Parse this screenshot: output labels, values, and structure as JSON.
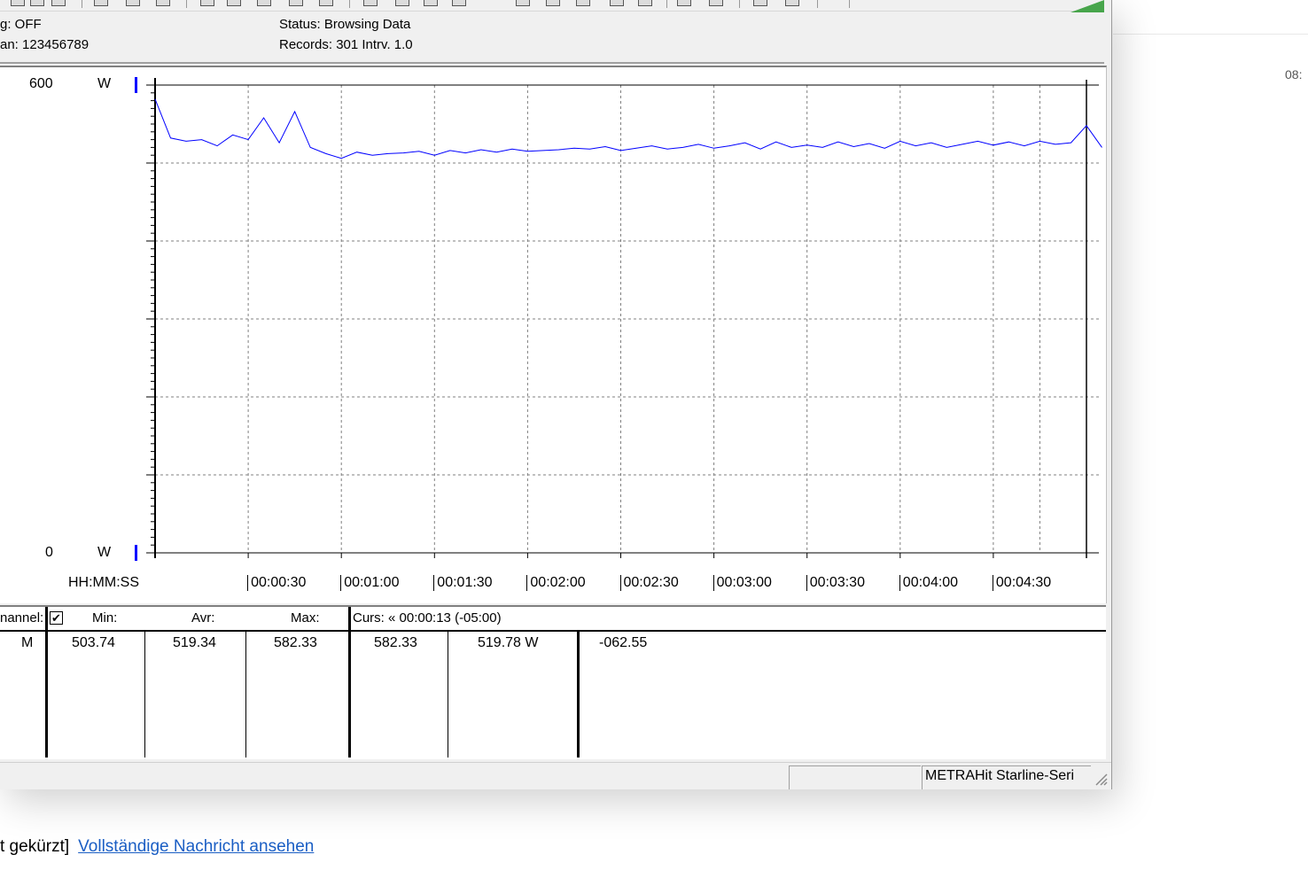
{
  "info": {
    "logging": "g: OFF",
    "scan": "an:  123456789",
    "status": "Status:   Browsing Data",
    "records": "Records: 301   Intrv. 1.0"
  },
  "chart_data": {
    "type": "line",
    "ylabel_top": "600",
    "ylabel_bottom": "0",
    "yunit": "W",
    "ylim": [
      0,
      600
    ],
    "xlabel": "HH:MM:SS",
    "xlim_seconds": [
      0,
      300
    ],
    "x_ticks": [
      "00:00:30",
      "00:01:00",
      "00:01:30",
      "00:02:00",
      "00:02:30",
      "00:03:00",
      "00:03:30",
      "00:04:00",
      "00:04:30"
    ],
    "grid": true,
    "series": [
      {
        "color": "#0000ff",
        "x_interval_s": 5,
        "values": [
          582,
          532,
          528,
          530,
          522,
          536,
          530,
          558,
          526,
          566,
          520,
          512,
          506,
          514,
          510,
          512,
          513,
          515,
          510,
          516,
          513,
          517,
          514,
          518,
          515,
          516,
          517,
          519,
          518,
          521,
          516,
          519,
          522,
          518,
          520,
          524,
          519,
          522,
          526,
          518,
          527,
          520,
          523,
          520,
          527,
          521,
          525,
          519,
          528,
          522,
          526,
          520,
          524,
          528,
          523,
          527,
          522,
          528,
          524,
          526,
          548,
          520
        ]
      }
    ]
  },
  "table": {
    "headers": {
      "channel": "nannel:",
      "min": "Min:",
      "avr": "Avr:",
      "max": "Max:",
      "curs": "Curs: « 00:00:13 (-05:00)"
    },
    "row": {
      "channel": "M",
      "min": "503.74",
      "avr": "519.34",
      "max": "582.33",
      "curs_val": "582.33",
      "curs_w": "519.78  W",
      "delta": "-062.55"
    }
  },
  "status_bar": {
    "device": "METRAHit Starline-Seri"
  },
  "page": {
    "time": "08:",
    "truncated": "t gekürzt]",
    "link": "Vollständige Nachricht ansehen"
  }
}
